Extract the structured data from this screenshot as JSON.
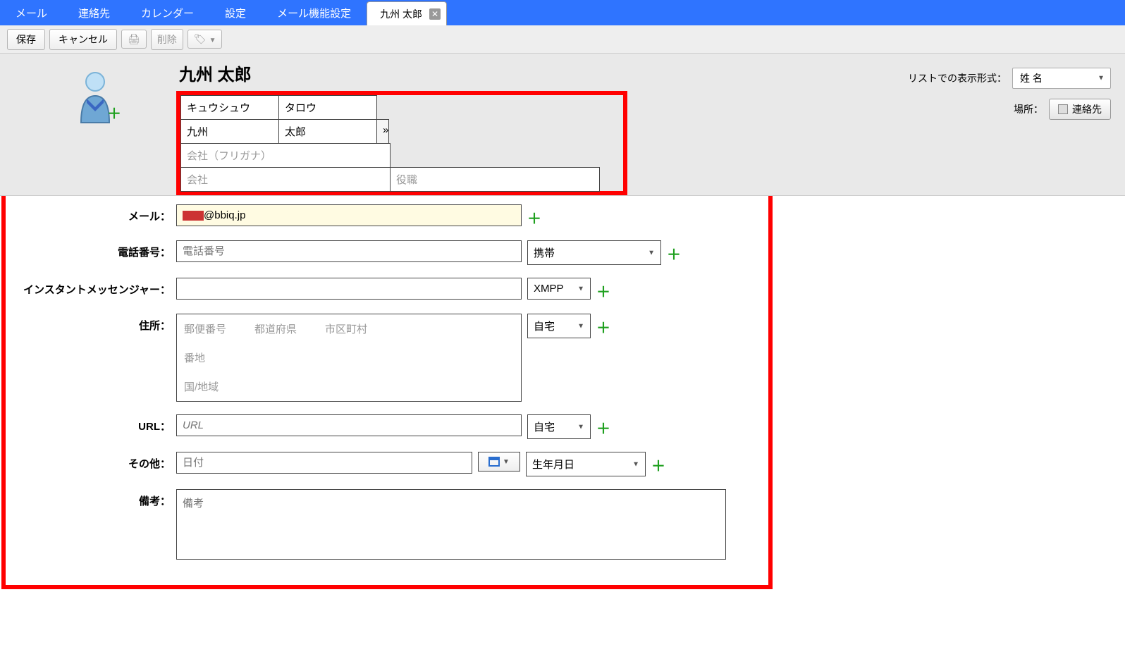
{
  "menubar": {
    "items": [
      "メール",
      "連絡先",
      "カレンダー",
      "設定",
      "メール機能設定"
    ],
    "active_tab": "九州 太郎"
  },
  "toolbar": {
    "save": "保存",
    "cancel": "キャンセル",
    "delete": "削除"
  },
  "contact": {
    "display_name": "九州 太郎",
    "list_format_label": "リストでの表示形式：",
    "list_format_value": "姓 名",
    "location_label": "場所：",
    "location_value": "連絡先",
    "kana_last": "キュウシュウ",
    "kana_first": "タロウ",
    "name_last": "九州",
    "name_first": "太郎",
    "expand": "»",
    "company_kana_ph": "会社（フリガナ）",
    "company_ph": "会社",
    "title_ph": "役職"
  },
  "fields": {
    "email_label": "メール：",
    "email_value": "@bbiq.jp",
    "phone_label": "電話番号：",
    "phone_ph": "電話番号",
    "phone_type": "携帯",
    "im_label": "インスタントメッセンジャー：",
    "im_type": "XMPP",
    "addr_label": "住所：",
    "addr_postal": "郵便番号",
    "addr_pref": "都道府県",
    "addr_city": "市区町村",
    "addr_street": "番地",
    "addr_country": "国/地域",
    "addr_type": "自宅",
    "url_label": "URL：",
    "url_ph": "URL",
    "url_type": "自宅",
    "other_label": "その他：",
    "other_ph": "日付",
    "other_type": "生年月日",
    "notes_label": "備考：",
    "notes_ph": "備考"
  }
}
